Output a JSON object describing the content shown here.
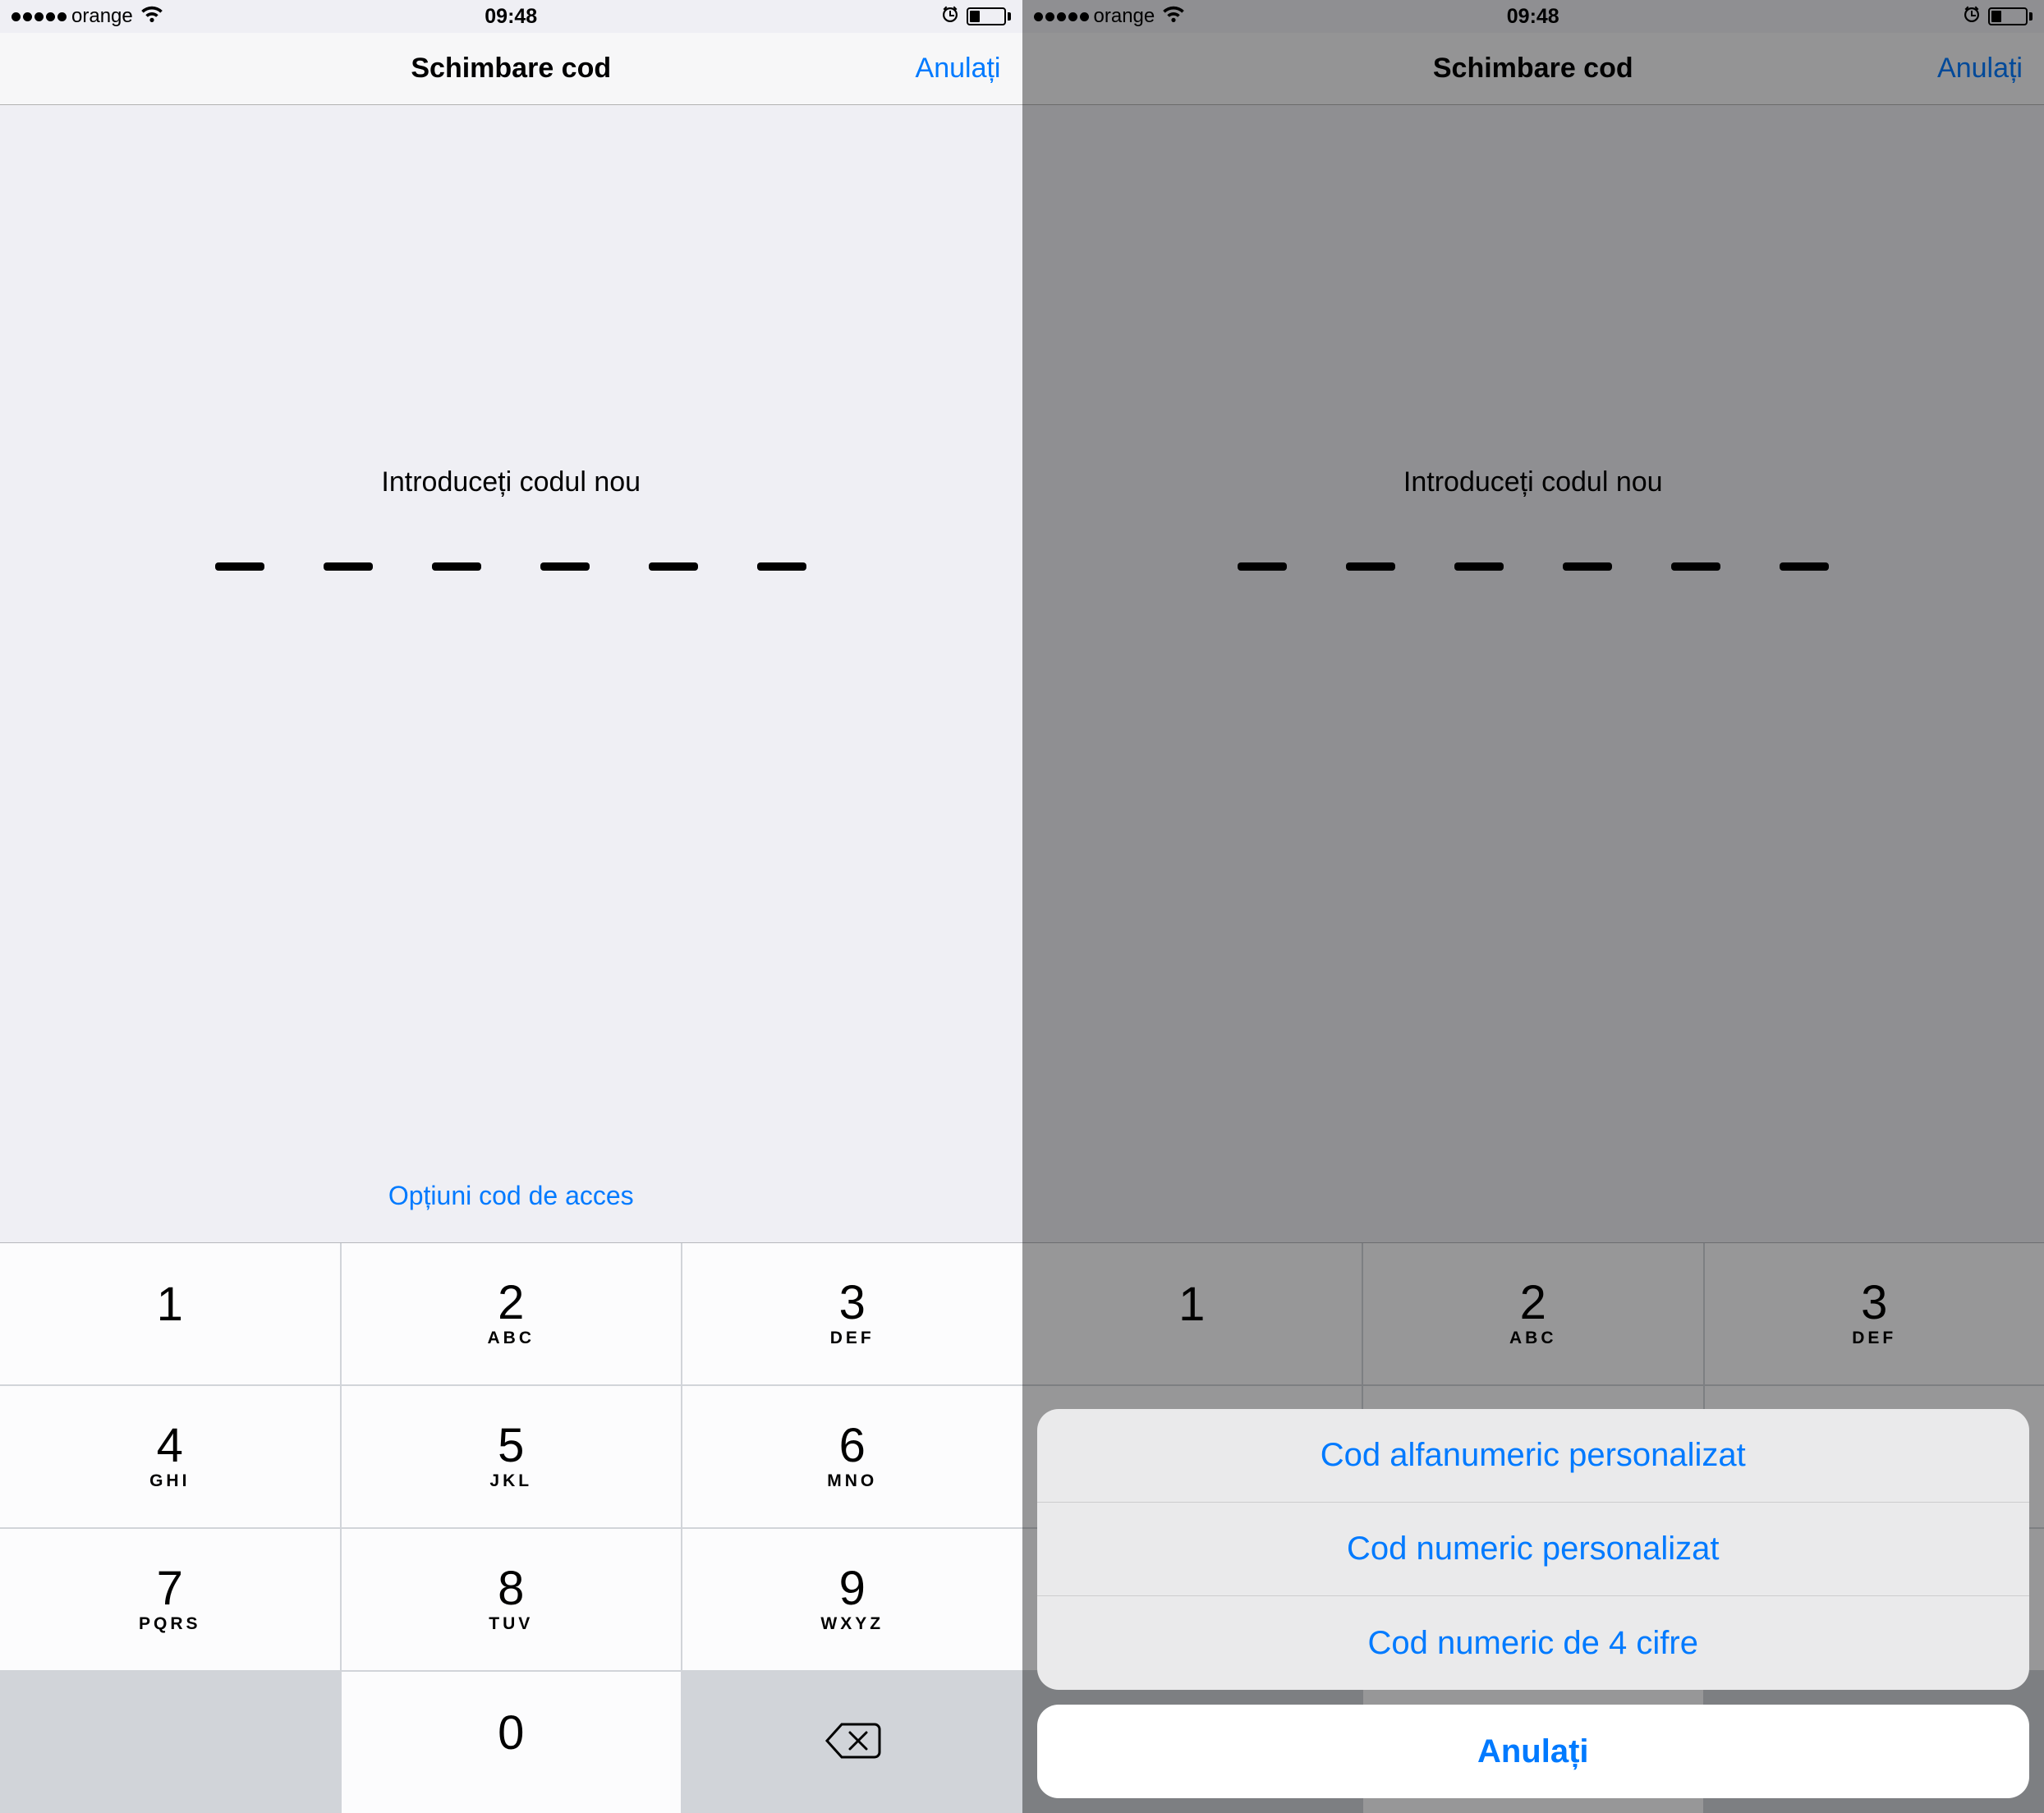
{
  "status": {
    "carrier": "orange",
    "time": "09:48"
  },
  "nav": {
    "title": "Schimbare cod",
    "cancel": "Anulați"
  },
  "body": {
    "prompt": "Introduceți codul nou",
    "options_link": "Opțiuni cod de acces"
  },
  "keypad": {
    "k1": "1",
    "k2": "2",
    "k3": "3",
    "k4": "4",
    "k5": "5",
    "k6": "6",
    "k7": "7",
    "k8": "8",
    "k9": "9",
    "k0": "0",
    "s2": "ABC",
    "s3": "DEF",
    "s4": "GHI",
    "s5": "JKL",
    "s6": "MNO",
    "s7": "PQRS",
    "s8": "TUV",
    "s9": "WXYZ"
  },
  "sheet": {
    "opt1": "Cod alfanumeric personalizat",
    "opt2": "Cod numeric personalizat",
    "opt3": "Cod numeric de 4 cifre",
    "cancel": "Anulați"
  }
}
